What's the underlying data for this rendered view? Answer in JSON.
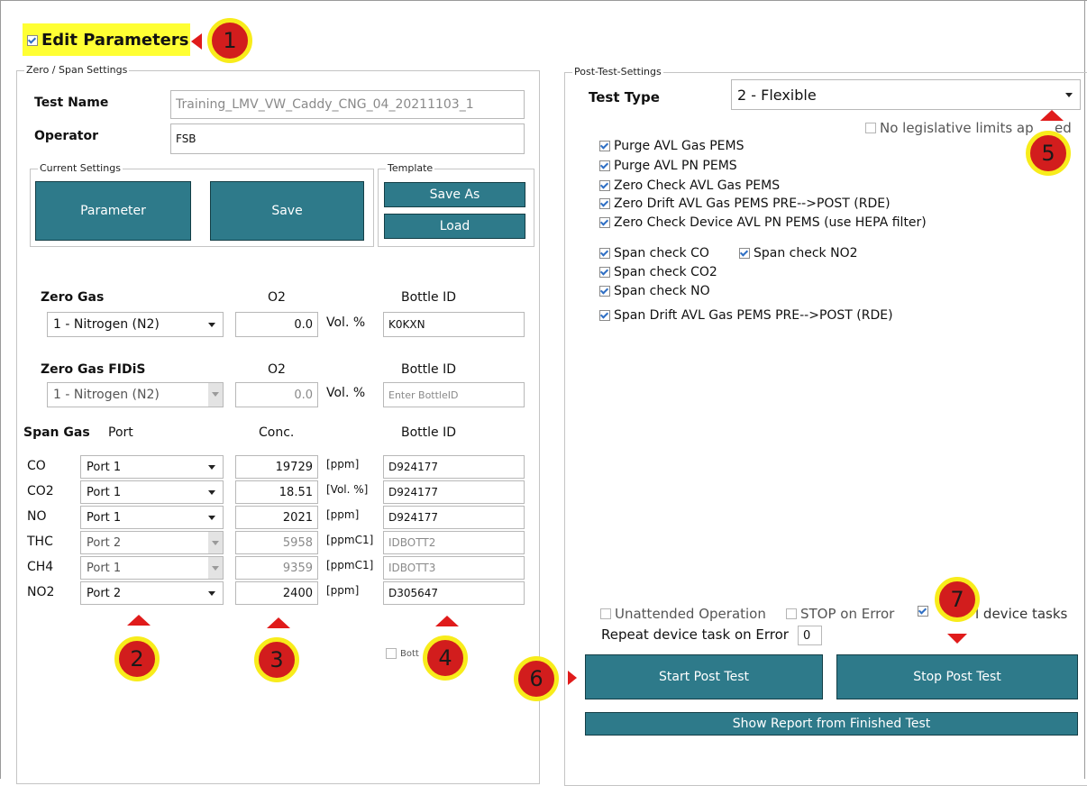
{
  "edit_parameters": {
    "label": "Edit Parameters",
    "checked": true
  },
  "zero_span": {
    "title": "Zero / Span Settings",
    "test_name_label": "Test Name",
    "test_name_value": "Training_LMV_VW_Caddy_CNG_04_20211103_1",
    "operator_label": "Operator",
    "operator_value": "FSB",
    "current_settings": {
      "title": "Current Settings",
      "parameter_label": "Parameter",
      "save_label": "Save"
    },
    "template": {
      "title": "Template",
      "save_as_label": "Save As",
      "load_label": "Load"
    },
    "zero_gas": {
      "label": "Zero Gas",
      "col_o2": "O2",
      "col_bottle": "Bottle ID",
      "gas": "1 - Nitrogen (N2)",
      "o2_value": "0.0",
      "unit": "Vol. %",
      "bottle_id": "K0KXN"
    },
    "zero_gas_fidis": {
      "label": "Zero Gas FIDiS",
      "col_o2": "O2",
      "col_bottle": "Bottle ID",
      "gas": "1 - Nitrogen (N2)",
      "o2_value": "0.0",
      "unit": "Vol. %",
      "bottle_placeholder": "Enter BottleID"
    },
    "span_gas": {
      "label": "Span Gas",
      "col_port": "Port",
      "col_conc": "Conc.",
      "col_bottle": "Bottle ID",
      "rows": [
        {
          "gas": "CO",
          "port": "Port 1",
          "conc": "19729",
          "unit": "[ppm]",
          "bottle": "D924177",
          "enabled": true
        },
        {
          "gas": "CO2",
          "port": "Port 1",
          "conc": "18.51",
          "unit": "[Vol. %]",
          "bottle": "D924177",
          "enabled": true
        },
        {
          "gas": "NO",
          "port": "Port 1",
          "conc": "2021",
          "unit": "[ppm]",
          "bottle": "D924177",
          "enabled": true
        },
        {
          "gas": "THC",
          "port": "Port 2",
          "conc": "5958",
          "unit": "[ppmC1]",
          "bottle": "IDBOTT2",
          "enabled": false
        },
        {
          "gas": "CH4",
          "port": "Port 1",
          "conc": "9359",
          "unit": "[ppmC1]",
          "bottle": "IDBOTT3",
          "enabled": false
        },
        {
          "gas": "NO2",
          "port": "Port 2",
          "conc": "2400",
          "unit": "[ppm]",
          "bottle": "D305647",
          "enabled": true
        }
      ]
    },
    "bottle_check_label": "Bott"
  },
  "post_test": {
    "title": "Post-Test-Settings",
    "test_type_label": "Test Type",
    "test_type_value": "2 - Flexible",
    "no_limits_label": "No legislative limits ap",
    "no_limits_tail": "ed",
    "tasks_a": [
      {
        "label": "Purge AVL Gas PEMS",
        "checked": true
      },
      {
        "label": "Purge AVL PN PEMS",
        "checked": true
      },
      {
        "label": "Zero Check AVL Gas PEMS",
        "checked": true
      },
      {
        "label": "Zero Drift AVL Gas PEMS PRE-->POST (RDE)",
        "checked": true
      },
      {
        "label": "Zero Check Device AVL PN PEMS (use HEPA filter)",
        "checked": true
      }
    ],
    "span_co": "Span check CO",
    "span_no2": "Span check NO2",
    "span_co2": "Span check CO2",
    "span_no": "Span check NO",
    "span_drift": "Span Drift AVL Gas PEMS PRE-->POST (RDE)",
    "unattended_label": "Unattended Operation",
    "stop_on_error_label": "STOP on Error",
    "all_tasks_tail": "l device tasks",
    "repeat_label": "Repeat device task on Error",
    "repeat_value": "0",
    "start_label": "Start Post Test",
    "stop_label": "Stop Post Test",
    "report_label": "Show Report from Finished Test"
  },
  "annotations": [
    "1",
    "2",
    "3",
    "4",
    "5",
    "6",
    "7"
  ],
  "colors": {
    "button": "#2e7a8a",
    "badge_fill": "#d21d1d",
    "badge_ring": "#f8ec1b",
    "highlight": "#ffff33",
    "arrow": "#e01b1b"
  }
}
